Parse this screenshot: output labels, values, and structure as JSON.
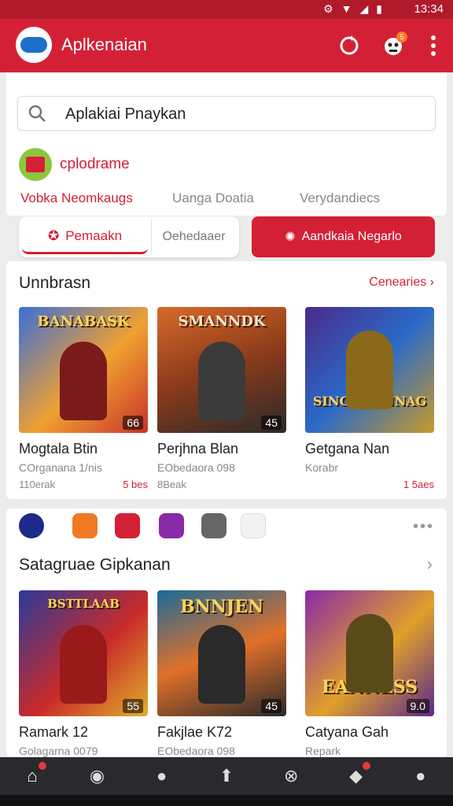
{
  "status": {
    "time": "13:34",
    "icons": [
      "gear-icon",
      "wifi-icon",
      "signal-icon",
      "battery-icon"
    ]
  },
  "app": {
    "title": "Aplkenaian",
    "notif_count": "5"
  },
  "search": {
    "value": "Aplakiai Pnaykan"
  },
  "brand": {
    "label": "cplodrame"
  },
  "subtabs": [
    "Vobka Neomkaugs",
    "Uanga Doatia",
    "Verydandiecs"
  ],
  "segment": {
    "active": "Pemaakn",
    "inactive": "Oehedaaer"
  },
  "cta": {
    "label": "Aandkaia Negarlo"
  },
  "section1": {
    "title": "Unnbrasn",
    "link": "Cenearies",
    "games": [
      {
        "art_title": "BANABASK",
        "price": "66",
        "name": "Mogtala Btin",
        "sub": "COrganana 1/nis",
        "count": "110erak",
        "rating": "5 bes",
        "colors": [
          "#3a6fd8",
          "#c8322a"
        ]
      },
      {
        "art_title": "SMANNDK",
        "price": "45",
        "name": "Perjhna Blan",
        "sub": "EObedaora 098",
        "count": "8Beak",
        "rating": "",
        "colors": [
          "#8a3a1a",
          "#3b3b3b"
        ]
      },
      {
        "art_title": "SINGNIK NNAG",
        "price": "",
        "name": "Getgana Nan",
        "sub": "Korabr",
        "count": "",
        "rating": "1 5aes",
        "colors": [
          "#4a2a8a",
          "#c89a2a"
        ]
      }
    ]
  },
  "mini_apps": [
    {
      "name": "app-icon-1",
      "color": "#1e2a8a"
    },
    {
      "name": "app-icon-2",
      "color": "#f07a22"
    },
    {
      "name": "app-icon-3",
      "color": "#d42035"
    },
    {
      "name": "app-icon-4",
      "color": "#8a2aa6"
    },
    {
      "name": "app-icon-5",
      "color": "#555555"
    },
    {
      "name": "app-icon-6",
      "color": "#eeeeee"
    }
  ],
  "section2": {
    "title": "Satagruae Gipkanan",
    "games": [
      {
        "art_title": "BSTTLAAB",
        "price": "55",
        "name": "Ramark 12",
        "sub": "Golagarna 0079",
        "colors": [
          "#2a3a9a",
          "#c82a2a"
        ]
      },
      {
        "art_title": "BNNJEN",
        "price": "45",
        "name": "Fakjlae K72",
        "sub": "EObedaora 098",
        "colors": [
          "#1a6a9a",
          "#2a2a2a"
        ]
      },
      {
        "art_title": "EANNESS",
        "price": "9.0",
        "name": "Catyana Gah",
        "sub": "Repark",
        "colors": [
          "#8a2aa6",
          "#e0a02a"
        ]
      }
    ]
  },
  "nav": [
    "home-icon",
    "game-icon",
    "profile-icon",
    "store-icon",
    "compass-icon",
    "chat-icon",
    "account-icon"
  ]
}
